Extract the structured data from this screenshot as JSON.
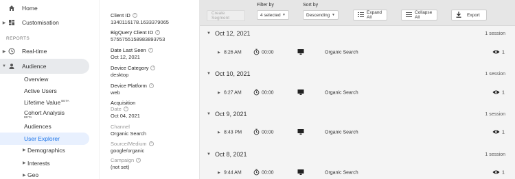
{
  "sidebar": {
    "home": "Home",
    "customisation": "Customisation",
    "reports_label": "REPORTS",
    "realtime": "Real-time",
    "audience": "Audience",
    "sub_items": {
      "overview": "Overview",
      "active_users": "Active Users",
      "lifetime_value": "Lifetime Value",
      "lifetime_value_badge": "BETA",
      "cohort_analysis": "Cohort Analysis",
      "cohort_badge": "BETA",
      "audiences": "Audiences",
      "user_explorer": "User Explorer",
      "demographics": "Demographics",
      "interests": "Interests",
      "geo": "Geo"
    }
  },
  "info": {
    "client_id_label": "Client ID",
    "client_id_value": "1340116178.1633379065",
    "bq_client_id_label": "BigQuery Client ID",
    "bq_client_id_value": "5755755158983893753",
    "date_last_seen_label": "Date Last Seen",
    "date_last_seen_value": "Oct 12, 2021",
    "device_category_label": "Device Category",
    "device_category_value": "desktop",
    "device_platform_label": "Device Platform",
    "device_platform_value": "web",
    "acquisition_label": "Acquisition",
    "date_label": "Date",
    "date_value": "Oct 04, 2021",
    "channel_label": "Channel",
    "channel_value": "Organic Search",
    "source_medium_label": "Source/Medium",
    "source_medium_value": "google/organic",
    "campaign_label": "Campaign",
    "campaign_value": "(not set)"
  },
  "toolbar": {
    "create_segment": "Create Segment",
    "filter_by_label": "Filter by",
    "filter_value": "4 selected",
    "sort_by_label": "Sort by",
    "sort_value": "Descending",
    "expand_all": "Expand All",
    "collapse_all": "Collapse All",
    "export": "Export"
  },
  "sessions": [
    {
      "date": "Oct 12, 2021",
      "count": "1 session",
      "time": "8:26 AM",
      "duration": "00:00",
      "source": "Organic Search",
      "views": "1"
    },
    {
      "date": "Oct 10, 2021",
      "count": "1 session",
      "time": "6:27 AM",
      "duration": "00:00",
      "source": "Organic Search",
      "views": "1"
    },
    {
      "date": "Oct 9, 2021",
      "count": "1 session",
      "time": "8:43 PM",
      "duration": "00:00",
      "source": "Organic Search",
      "views": "1"
    },
    {
      "date": "Oct 8, 2021",
      "count": "1 session",
      "time": "9:44 AM",
      "duration": "00:00",
      "source": "Organic Search",
      "views": "1"
    }
  ]
}
